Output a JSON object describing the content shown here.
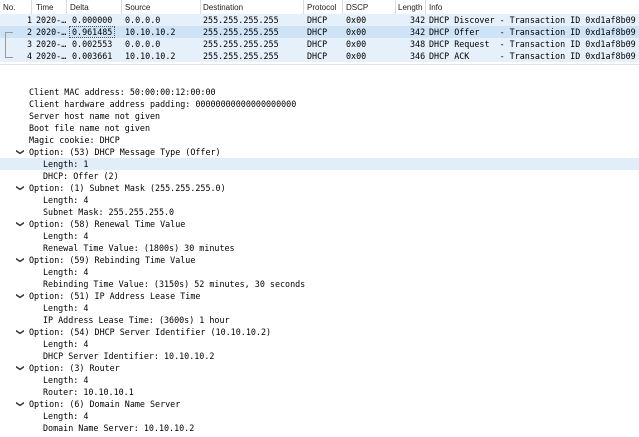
{
  "columns": [
    "No.",
    "Time",
    "Delta",
    "Source",
    "Destination",
    "Protocol",
    "DSCP",
    "Length",
    "Info"
  ],
  "packets": [
    {
      "no": "1",
      "time": "2020-…",
      "delta": "0.000000",
      "src": "0.0.0.0",
      "dst": "255.255.255.255",
      "proto": "DHCP",
      "dscp": "0x00",
      "len": "342",
      "info": "DHCP Discover - Transaction ID 0xd1af8b09"
    },
    {
      "no": "2",
      "time": "2020-…",
      "delta": "0.961485",
      "src": "10.10.10.2",
      "dst": "255.255.255.255",
      "proto": "DHCP",
      "dscp": "0x00",
      "len": "342",
      "info": "DHCP Offer    - Transaction ID 0xd1af8b09"
    },
    {
      "no": "3",
      "time": "2020-…",
      "delta": "0.002553",
      "src": "0.0.0.0",
      "dst": "255.255.255.255",
      "proto": "DHCP",
      "dscp": "0x00",
      "len": "348",
      "info": "DHCP Request  - Transaction ID 0xd1af8b09"
    },
    {
      "no": "4",
      "time": "2020-…",
      "delta": "0.003661",
      "src": "10.10.10.2",
      "dst": "255.255.255.255",
      "proto": "DHCP",
      "dscp": "0x00",
      "len": "346",
      "info": "DHCP ACK      - Transaction ID 0xd1af8b09"
    }
  ],
  "details": [
    "Client MAC address: 50:00:00:12:00:00",
    "Client hardware address padding: 00000000000000000000",
    "Server host name not given",
    "Boot file name not given",
    "Magic cookie: DHCP",
    "Option: (53) DHCP Message Type (Offer)",
    "Length: 1",
    "DHCP: Offer (2)",
    "Option: (1) Subnet Mask (255.255.255.0)",
    "Length: 4",
    "Subnet Mask: 255.255.255.0",
    "Option: (58) Renewal Time Value",
    "Length: 4",
    "Renewal Time Value: (1800s) 30 minutes",
    "Option: (59) Rebinding Time Value",
    "Length: 4",
    "Rebinding Time Value: (3150s) 52 minutes, 30 seconds",
    "Option: (51) IP Address Lease Time",
    "Length: 4",
    "IP Address Lease Time: (3600s) 1 hour",
    "Option: (54) DHCP Server Identifier (10.10.10.2)",
    "Length: 4",
    "DHCP Server Identifier: 10.10.10.2",
    "Option: (3) Router",
    "Length: 4",
    "Router: 10.10.10.1",
    "Option: (6) Domain Name Server",
    "Length: 4",
    "Domain Name Server: 10.10.10.2"
  ]
}
